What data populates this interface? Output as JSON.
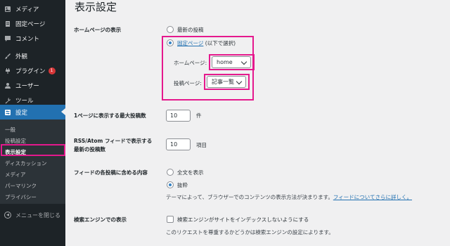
{
  "sidebar": {
    "items": [
      {
        "label": "メディア",
        "icon": "media-icon",
        "badge": ""
      },
      {
        "label": "固定ページ",
        "icon": "pages-icon",
        "badge": ""
      },
      {
        "label": "コメント",
        "icon": "comments-icon",
        "badge": ""
      },
      {
        "label": "外観",
        "icon": "appearance-icon",
        "badge": ""
      },
      {
        "label": "プラグイン",
        "icon": "plugins-icon",
        "badge": "1"
      },
      {
        "label": "ユーザー",
        "icon": "users-icon",
        "badge": ""
      },
      {
        "label": "ツール",
        "icon": "tools-icon",
        "badge": ""
      },
      {
        "label": "設定",
        "icon": "settings-icon",
        "badge": ""
      }
    ],
    "submenu": [
      "一般",
      "投稿設定",
      "表示設定",
      "ディスカッション",
      "メディア",
      "パーマリンク",
      "プライバシー"
    ],
    "collapse_label": "メニューを閉じる"
  },
  "page": {
    "title": "表示設定",
    "homepage": {
      "label": "ホームページの表示",
      "option_latest": "最新の投稿",
      "option_static_link": "固定ページ",
      "option_static_suffix": " (以下で選択)",
      "homepage_label": "ホームページ:",
      "homepage_value": "home",
      "posts_label": "投稿ページ:",
      "posts_value": "記事一覧"
    },
    "posts_per_page": {
      "label": "1ページに表示する最大投稿数",
      "value": "10",
      "unit": "件"
    },
    "feed_count": {
      "label_line1": "RSS/Atom フィードで表示する",
      "label_line2": "最新の投稿数",
      "value": "10",
      "unit": "項目"
    },
    "feed_content": {
      "label": "フィードの各投稿に含める内容",
      "option_full": "全文を表示",
      "option_excerpt": "抜粋",
      "note": "テーマによって、ブラウザーでのコンテンツの表示方法が決まります。",
      "note_link": "フィードについてさらに詳しく。"
    },
    "search_engine": {
      "label": "検索エンジンでの表示",
      "checkbox_label": "検索エンジンがサイトをインデックスしないようにする",
      "note": "このリクエストを尊重するかどうかは検索エンジンの設定によります。"
    }
  },
  "colors": {
    "accent": "#2271b1",
    "highlight": "#e5198d",
    "sidebar": "#1d2327"
  }
}
